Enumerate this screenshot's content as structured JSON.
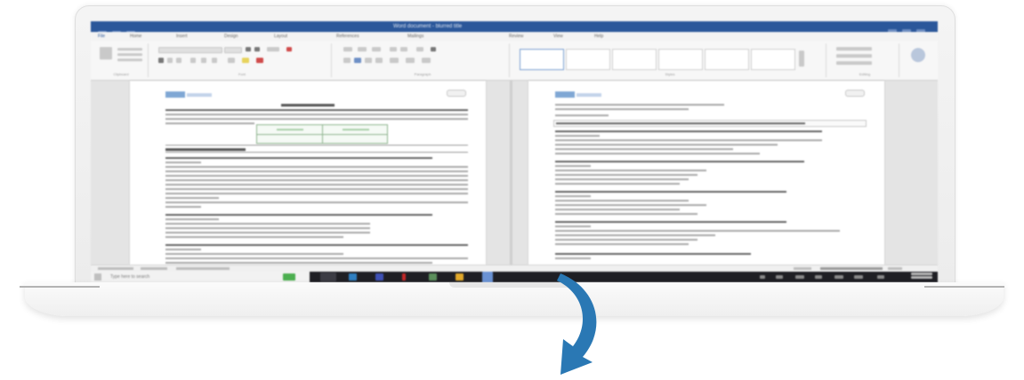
{
  "window": {
    "title": "Word document - blurred title",
    "close_label": ""
  },
  "ribbon": {
    "tabs": [
      "File",
      "Home",
      "Insert",
      "Design",
      "Layout",
      "References",
      "Mailings",
      "Review",
      "View",
      "Help"
    ],
    "groups": [
      "Clipboard",
      "Font",
      "Paragraph",
      "Styles",
      "Editing"
    ]
  },
  "taskbar": {
    "search_placeholder": "Type here to search"
  },
  "colors": {
    "title_bar": "#2b579a",
    "taskbar": "#1f1f24",
    "arrow": "#2a78b4"
  },
  "icons": [
    "windows-icon",
    "search-icon",
    "task-view-icon",
    "edge-icon",
    "file-explorer-icon",
    "word-icon",
    "arrow-down-icon"
  ]
}
